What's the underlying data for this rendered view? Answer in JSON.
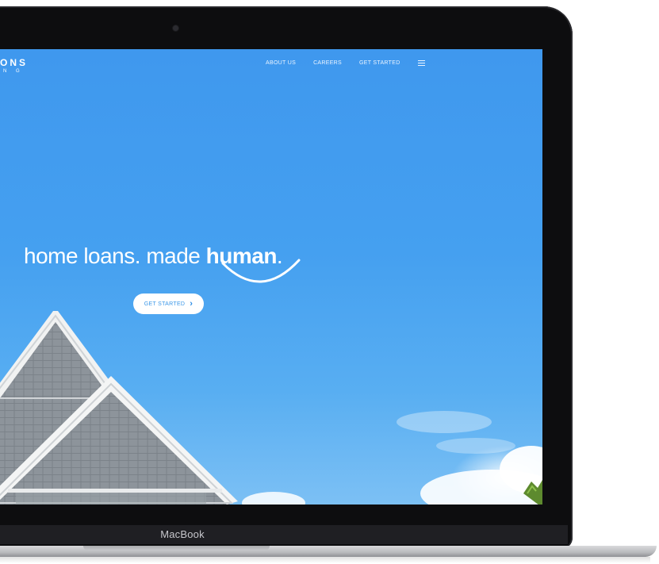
{
  "site": {
    "logo_main": "ONS",
    "logo_sub": "N G"
  },
  "nav": {
    "items": [
      "ABOUT US",
      "CAREERS",
      "GET STARTED"
    ]
  },
  "hero": {
    "headline_light": "home loans. made ",
    "headline_bold": "human",
    "headline_dot": "."
  },
  "cta": {
    "label": "GET STARTED"
  },
  "device": {
    "brand": "MacBook"
  },
  "colors": {
    "sky_top": "#3f98ee",
    "sky_bottom": "#7cc0f4",
    "accent": "#2f8ee6",
    "bezel": "#0d0d0f"
  }
}
